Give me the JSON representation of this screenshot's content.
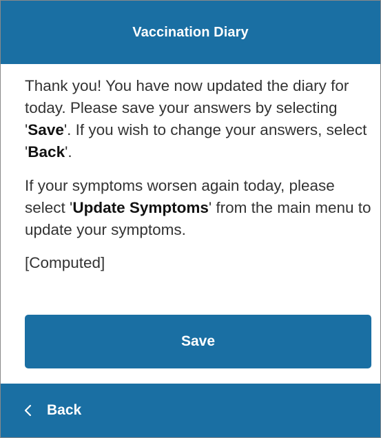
{
  "header": {
    "title": "Vaccination Diary"
  },
  "message": {
    "p1_before_save": "Thank you! You have now updated the diary for today. Please save your answers by selecting '",
    "p1_save": "Save",
    "p1_between": "'. If you wish to change your answers, select '",
    "p1_back": "Back",
    "p1_after": "'.",
    "p2_before": "If your symptoms worsen again today, please select '",
    "p2_update": "Update Symptoms",
    "p2_after": "' from the main menu to update your symptoms.",
    "computed": "[Computed]"
  },
  "actions": {
    "save_label": "Save"
  },
  "footer": {
    "back_label": "Back",
    "back_icon": "chevron-left-icon"
  },
  "colors": {
    "brand": "#1a6fa3",
    "text": "#333333",
    "on_brand": "#ffffff"
  }
}
